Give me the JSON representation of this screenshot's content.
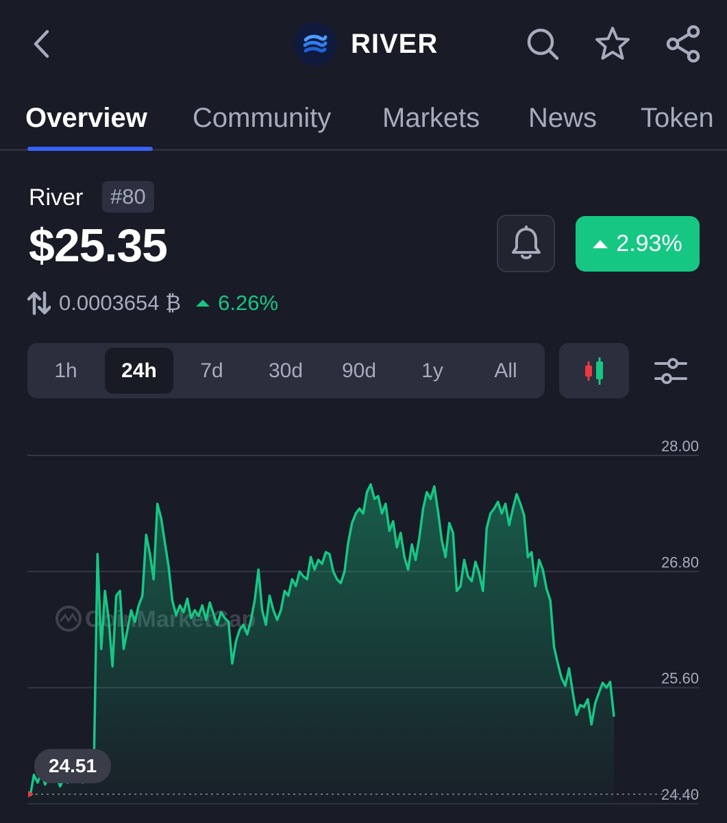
{
  "header": {
    "coin_name": "RIVER",
    "icons": [
      "chevron-left-icon",
      "river-logo-icon",
      "search-icon",
      "star-icon",
      "share-icon"
    ]
  },
  "tabs": [
    {
      "label": "Overview",
      "active": true
    },
    {
      "label": "Community",
      "active": false
    },
    {
      "label": "Markets",
      "active": false
    },
    {
      "label": "News",
      "active": false
    },
    {
      "label": "Token",
      "active": false
    }
  ],
  "price_block": {
    "name": "River",
    "rank": "#80",
    "price": "$25.35",
    "change_24h": "2.93%",
    "btc_price": "0.0003654 ₿",
    "btc_change": "6.26%"
  },
  "range": {
    "options": [
      "1h",
      "24h",
      "7d",
      "30d",
      "90d",
      "1y",
      "All"
    ],
    "selected": "24h"
  },
  "colors": {
    "background": "#191b26",
    "accent": "#3861fb",
    "positive": "#16c784",
    "negative": "#ea3943"
  },
  "chart_data": {
    "type": "area",
    "watermark": "CoinMarketCap",
    "y_ticks": [
      "28.00",
      "26.80",
      "25.60",
      "24.40"
    ],
    "ylim": [
      24.4,
      28.0
    ],
    "grid": true,
    "open_label": "24.51",
    "series": [
      {
        "values": [
          24.48,
          24.7,
          24.62,
          24.72,
          24.6,
          24.68,
          24.63,
          24.7,
          24.58,
          24.66,
          24.62,
          24.69,
          24.67,
          24.7,
          24.62,
          24.7,
          24.74,
          24.7,
          26.98,
          26.0,
          26.6,
          26.3,
          25.82,
          26.55,
          26.6,
          26.0,
          26.2,
          26.4,
          26.28,
          26.45,
          26.55,
          27.18,
          26.98,
          26.72,
          27.5,
          27.35,
          27.1,
          26.85,
          26.5,
          26.35,
          26.45,
          26.38,
          26.52,
          26.32,
          26.4,
          26.34,
          26.45,
          26.3,
          26.48,
          26.36,
          26.25,
          26.38,
          26.32,
          26.28,
          25.85,
          26.08,
          26.2,
          26.25,
          26.15,
          26.3,
          26.5,
          26.82,
          26.4,
          26.25,
          26.55,
          26.4,
          26.3,
          26.4,
          26.6,
          26.55,
          26.72,
          26.65,
          26.8,
          26.75,
          26.72,
          26.95,
          26.82,
          26.92,
          26.88,
          27.0,
          26.98,
          26.8,
          26.72,
          26.68,
          26.8,
          27.1,
          27.3,
          27.4,
          27.45,
          27.4,
          27.62,
          27.7,
          27.55,
          27.58,
          27.4,
          27.5,
          27.22,
          27.32,
          27.05,
          27.2,
          26.95,
          26.82,
          27.08,
          26.92,
          27.15,
          27.45,
          27.62,
          27.55,
          27.68,
          27.42,
          27.12,
          26.95,
          27.3,
          27.2,
          26.6,
          26.65,
          26.92,
          26.75,
          26.7,
          26.9,
          26.78,
          26.6,
          27.25,
          27.4,
          27.45,
          27.52,
          27.4,
          27.5,
          27.28,
          27.45,
          27.6,
          27.5,
          27.38,
          26.95,
          27.0,
          26.65,
          26.92,
          26.82,
          26.62,
          26.5,
          26.02,
          25.85,
          25.7,
          25.62,
          25.8,
          25.55,
          25.32,
          25.42,
          25.4,
          25.48,
          25.22,
          25.44,
          25.55,
          25.65,
          25.6,
          25.66,
          25.3
        ]
      }
    ]
  }
}
